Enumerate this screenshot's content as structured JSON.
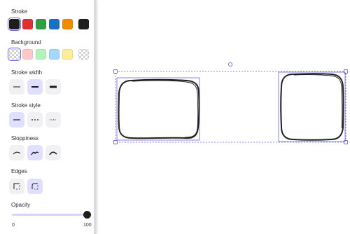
{
  "panel": {
    "stroke": {
      "title": "Stroke",
      "colors": [
        "#1e1e1e",
        "#e03131",
        "#2f9e44",
        "#1971c2",
        "#f08c00"
      ],
      "selected_color": "#1e1e1e"
    },
    "background": {
      "title": "Background",
      "colors": [
        "transparent",
        "#ffc9c9",
        "#b2f2bb",
        "#a5d8ff",
        "#ffec99"
      ],
      "selected_color": "transparent"
    },
    "stroke_width": {
      "title": "Stroke width",
      "options": [
        "thin",
        "bold",
        "extra-bold"
      ],
      "selected": "bold"
    },
    "stroke_style": {
      "title": "Stroke style",
      "options": [
        "solid",
        "dashed",
        "dotted"
      ],
      "selected": "solid"
    },
    "sloppiness": {
      "title": "Sloppiness",
      "options": [
        "architect",
        "artist",
        "cartoonist"
      ],
      "selected": "artist"
    },
    "edges": {
      "title": "Edges",
      "options": [
        "sharp",
        "round"
      ],
      "selected": "round"
    },
    "opacity": {
      "title": "Opacity",
      "value": 100,
      "min_label": "0",
      "max_label": "100"
    }
  },
  "colors": {
    "accent": "#6965db",
    "accent_light": "#e0dfff"
  }
}
